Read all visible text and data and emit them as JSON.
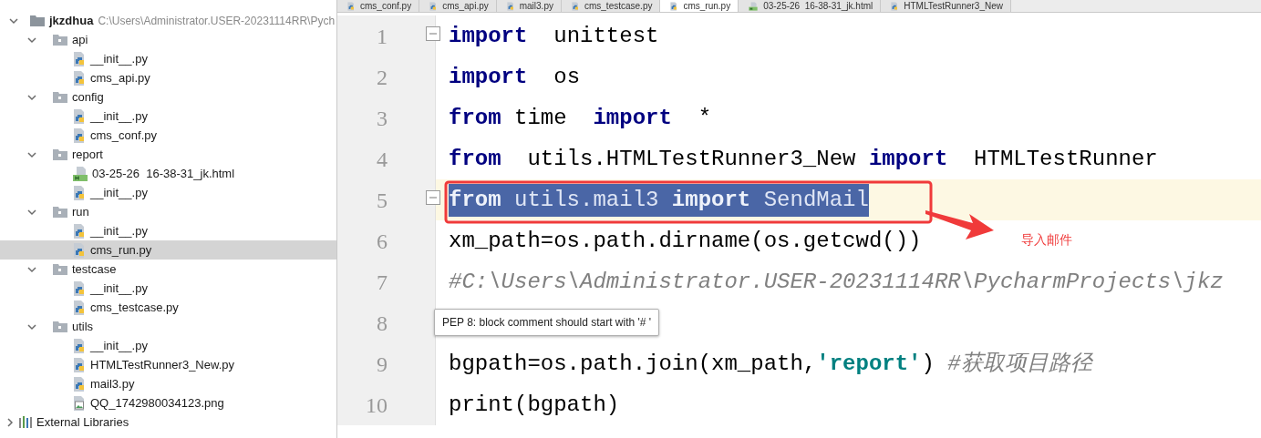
{
  "tabs": [
    {
      "label": "cms_conf.py",
      "kind": "python",
      "selected": false
    },
    {
      "label": "cms_api.py",
      "kind": "python",
      "selected": false
    },
    {
      "label": "mail3.py",
      "kind": "python",
      "selected": false
    },
    {
      "label": "cms_testcase.py",
      "kind": "python",
      "selected": false
    },
    {
      "label": "cms_run.py",
      "kind": "python",
      "selected": true
    },
    {
      "label": "03-25-26  16-38-31_jk.html",
      "kind": "html",
      "selected": false
    },
    {
      "label": "HTMLTestRunner3_New",
      "kind": "python",
      "selected": false
    }
  ],
  "project_tree": {
    "root": {
      "label": "jkzdhua",
      "path": "C:\\Users\\Administrator.USER-20231114RR\\Pych",
      "expanded": true,
      "children": [
        {
          "label": "api",
          "kind": "folder",
          "expanded": true,
          "selected": false,
          "children": [
            {
              "label": "__init__.py",
              "kind": "python",
              "selected": false
            },
            {
              "label": "cms_api.py",
              "kind": "python",
              "selected": false
            }
          ]
        },
        {
          "label": "config",
          "kind": "folder",
          "expanded": true,
          "selected": false,
          "children": [
            {
              "label": "__init__.py",
              "kind": "python",
              "selected": false
            },
            {
              "label": "cms_conf.py",
              "kind": "python",
              "selected": false
            }
          ]
        },
        {
          "label": "report",
          "kind": "folder",
          "expanded": true,
          "selected": false,
          "children": [
            {
              "label": "03-25-26  16-38-31_jk.html",
              "kind": "html",
              "selected": false
            },
            {
              "label": "__init__.py",
              "kind": "python",
              "selected": false
            }
          ]
        },
        {
          "label": "run",
          "kind": "folder",
          "expanded": true,
          "selected": false,
          "children": [
            {
              "label": "__init__.py",
              "kind": "python",
              "selected": false
            },
            {
              "label": "cms_run.py",
              "kind": "python",
              "selected": true
            }
          ]
        },
        {
          "label": "testcase",
          "kind": "folder",
          "expanded": true,
          "selected": false,
          "children": [
            {
              "label": "__init__.py",
              "kind": "python",
              "selected": false
            },
            {
              "label": "cms_testcase.py",
              "kind": "python",
              "selected": false
            }
          ]
        },
        {
          "label": "utils",
          "kind": "folder",
          "expanded": true,
          "selected": false,
          "children": [
            {
              "label": "__init__.py",
              "kind": "python",
              "selected": false
            },
            {
              "label": "HTMLTestRunner3_New.py",
              "kind": "python",
              "selected": false
            },
            {
              "label": "mail3.py",
              "kind": "python",
              "selected": false
            },
            {
              "label": "QQ_1742980034123.png",
              "kind": "image",
              "selected": false
            }
          ]
        }
      ]
    },
    "external": {
      "label": "External Libraries",
      "expanded": false
    }
  },
  "code_lines": [
    {
      "number": "1",
      "fold": true,
      "current": false,
      "selected": false,
      "tokens": [
        {
          "kind": "keyword",
          "text": "import"
        },
        {
          "kind": "plain",
          "text": "  unittest"
        }
      ]
    },
    {
      "number": "2",
      "fold": false,
      "current": false,
      "selected": false,
      "tokens": [
        {
          "kind": "keyword",
          "text": "import"
        },
        {
          "kind": "plain",
          "text": "  os"
        }
      ]
    },
    {
      "number": "3",
      "fold": false,
      "current": false,
      "selected": false,
      "tokens": [
        {
          "kind": "keyword",
          "text": "from"
        },
        {
          "kind": "plain",
          "text": " time  "
        },
        {
          "kind": "keyword",
          "text": "import"
        },
        {
          "kind": "plain",
          "text": "  *"
        }
      ]
    },
    {
      "number": "4",
      "fold": false,
      "current": false,
      "selected": false,
      "tokens": [
        {
          "kind": "keyword",
          "text": "from"
        },
        {
          "kind": "plain",
          "text": "  utils.HTMLTestRunner3_New "
        },
        {
          "kind": "keyword",
          "text": "import"
        },
        {
          "kind": "plain",
          "text": "  HTMLTestRunner"
        }
      ]
    },
    {
      "number": "5",
      "fold": true,
      "current": true,
      "selected": true,
      "tokens": [
        {
          "kind": "keyword",
          "text": "from"
        },
        {
          "kind": "plain",
          "text": " utils.mail3 "
        },
        {
          "kind": "keyword",
          "text": "import"
        },
        {
          "kind": "plain",
          "text": " SendMail"
        }
      ]
    },
    {
      "number": "6",
      "fold": false,
      "current": false,
      "selected": false,
      "tokens": [
        {
          "kind": "plain",
          "text": "xm_path=os.path.dirname(os.getcwd())"
        }
      ]
    },
    {
      "number": "7",
      "fold": false,
      "current": false,
      "selected": false,
      "tokens": [
        {
          "kind": "comment",
          "text": "#C:\\Users\\Administrator.USER-20231114RR\\PycharmProjects\\jkz"
        }
      ]
    },
    {
      "number": "8",
      "fold": false,
      "current": false,
      "selected": false
    },
    {
      "number": "9",
      "fold": false,
      "current": false,
      "selected": false,
      "tokens": [
        {
          "kind": "plain",
          "text": "bgpath=os.path.join(xm_path,"
        },
        {
          "kind": "string",
          "text": "'report'"
        },
        {
          "kind": "plain",
          "text": ") "
        },
        {
          "kind": "comment",
          "text": "#获取项目路径"
        }
      ]
    },
    {
      "number": "10",
      "fold": false,
      "current": false,
      "selected": false,
      "tokens": [
        {
          "kind": "plain",
          "text": "print(bgpath)"
        }
      ]
    }
  ],
  "tooltip": {
    "text": "PEP 8: block comment should start with '# '"
  },
  "annotation": {
    "text": "导入邮件"
  }
}
